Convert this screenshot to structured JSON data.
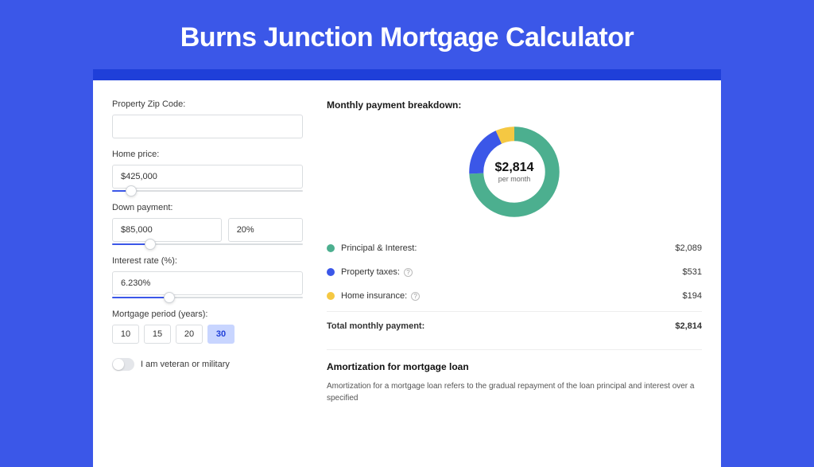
{
  "page_title": "Burns Junction Mortgage Calculator",
  "form": {
    "zip_label": "Property Zip Code:",
    "zip_value": "",
    "price_label": "Home price:",
    "price_value": "$425,000",
    "price_slider_pct": 10,
    "down_label": "Down payment:",
    "down_amount": "$85,000",
    "down_pct": "20%",
    "down_slider_pct": 20,
    "rate_label": "Interest rate (%):",
    "rate_value": "6.230%",
    "rate_slider_pct": 30,
    "period_label": "Mortgage period (years):",
    "period_options": [
      "10",
      "15",
      "20",
      "30"
    ],
    "period_selected": "30",
    "veteran_label": "I am veteran or military"
  },
  "breakdown": {
    "title": "Monthly payment breakdown:",
    "center_value": "$2,814",
    "center_sub": "per month",
    "items": [
      {
        "label": "Principal & Interest:",
        "amount": "$2,089",
        "color": "#4caf8f",
        "info": false,
        "pct": 74.2
      },
      {
        "label": "Property taxes:",
        "amount": "$531",
        "color": "#3b57e8",
        "info": true,
        "pct": 18.9
      },
      {
        "label": "Home insurance:",
        "amount": "$194",
        "color": "#f5c842",
        "info": true,
        "pct": 6.9
      }
    ],
    "total_label": "Total monthly payment:",
    "total_amount": "$2,814"
  },
  "amort": {
    "title": "Amortization for mortgage loan",
    "body": "Amortization for a mortgage loan refers to the gradual repayment of the loan principal and interest over a specified"
  },
  "chart_data": {
    "type": "pie",
    "title": "Monthly payment breakdown",
    "series": [
      {
        "name": "Principal & Interest",
        "value": 2089,
        "color": "#4caf8f"
      },
      {
        "name": "Property taxes",
        "value": 531,
        "color": "#3b57e8"
      },
      {
        "name": "Home insurance",
        "value": 194,
        "color": "#f5c842"
      }
    ],
    "total": 2814,
    "unit": "USD/month"
  }
}
